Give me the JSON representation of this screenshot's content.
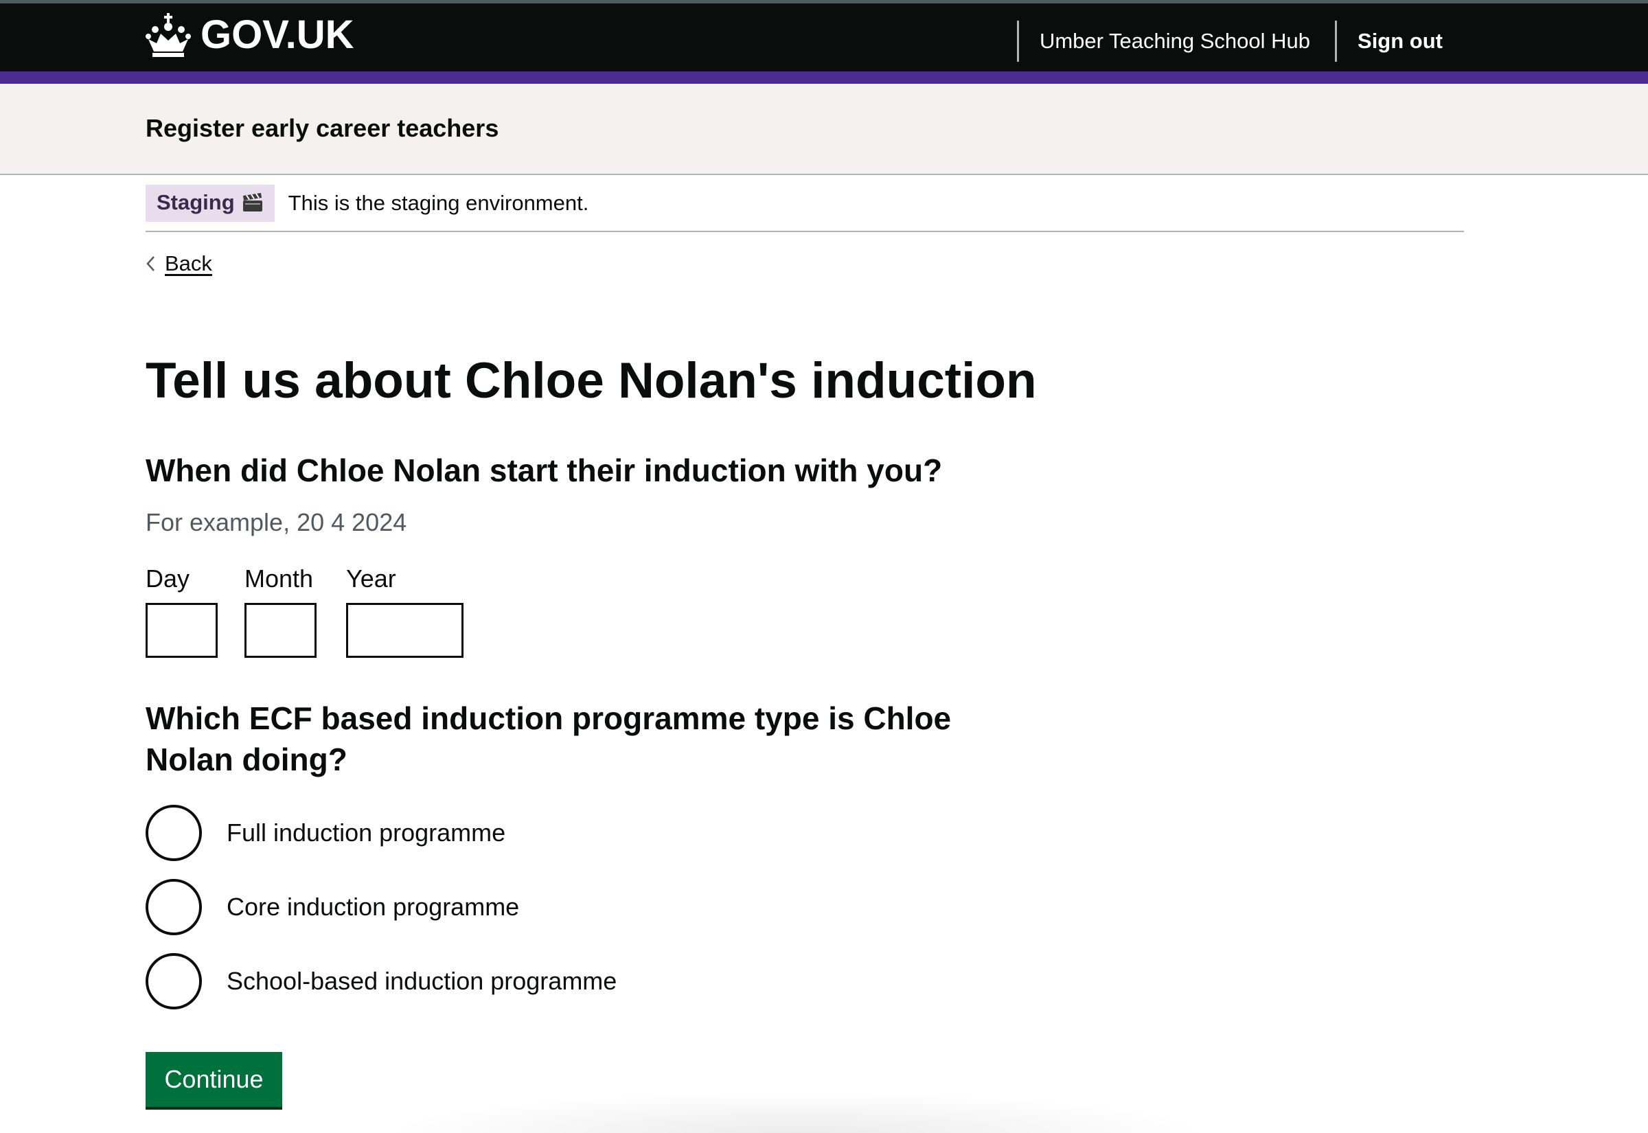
{
  "header": {
    "logo_text": "GOV.UK",
    "organisation": "Umber Teaching School Hub",
    "sign_out": "Sign out"
  },
  "service": {
    "name": "Register early career teachers"
  },
  "phase_banner": {
    "tag": "Staging",
    "tag_icon": "clapperboard-icon",
    "text": "This is the staging environment."
  },
  "back_link": "Back",
  "page_title": "Tell us about Chloe Nolan's induction",
  "start_date": {
    "legend": "When did Chloe Nolan start their induction with you?",
    "hint": "For example, 20 4 2024",
    "fields": [
      {
        "label": "Day",
        "value": ""
      },
      {
        "label": "Month",
        "value": ""
      },
      {
        "label": "Year",
        "value": ""
      }
    ]
  },
  "programme_type": {
    "legend": "Which ECF based induction programme type is Chloe Nolan doing?",
    "options": [
      {
        "label": "Full induction programme",
        "selected": false
      },
      {
        "label": "Core induction programme",
        "selected": false
      },
      {
        "label": "School-based induction programme",
        "selected": false
      }
    ]
  },
  "continue_label": "Continue",
  "colors": {
    "header_bg": "#0b0c0c",
    "stripe": "#4c2c92",
    "service_bar_bg": "#f3f2f1",
    "staging_tag_bg": "#e9dded",
    "button_green": "#00703c"
  }
}
